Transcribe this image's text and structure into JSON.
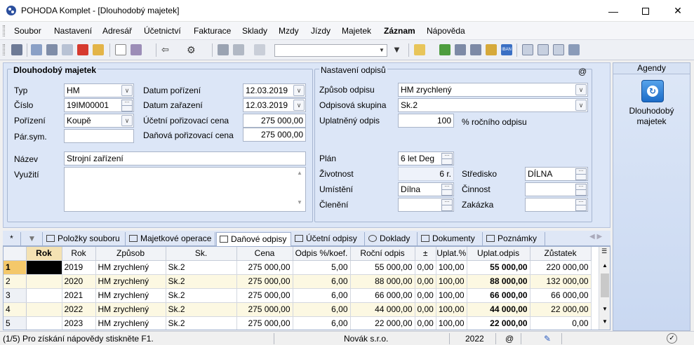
{
  "window": {
    "title": "POHODA Komplet - [Dlouhodobý majetek]"
  },
  "menu": [
    "Soubor",
    "Nastavení",
    "Adresář",
    "Účetnictví",
    "Fakturace",
    "Sklady",
    "Mzdy",
    "Jízdy",
    "Majetek",
    "Záznam",
    "Nápověda"
  ],
  "form": {
    "section_title": "Dlouhodobý majetek",
    "typ_label": "Typ",
    "typ_value": "HM",
    "cislo_label": "Číslo",
    "cislo_value": "19IM00001",
    "porizeni_label": "Pořízení",
    "porizeni_value": "Koupě",
    "parsym_label": "Pár.sym.",
    "datum_porizeni_label": "Datum pořízení",
    "datum_porizeni_value": "12.03.2019",
    "datum_zarazeni_label": "Datum zařazení",
    "datum_zarazeni_value": "12.03.2019",
    "ucetni_cena_label": "Účetní pořizovací cena",
    "ucetni_cena_value": "275 000,00",
    "danova_cena_label": "Daňová pořizovací cena",
    "danova_cena_value": "275 000,00",
    "nazev_label": "Název",
    "nazev_value": "Strojní zařízení",
    "vyuziti_label": "Využití"
  },
  "odpisy": {
    "section_title": "Nastavení odpisů",
    "at": "@",
    "zpusob_label": "Způsob odpisu",
    "zpusob_value": "HM zrychlený",
    "skupina_label": "Odpisová skupina",
    "skupina_value": "Sk.2",
    "uplatneny_label": "Uplatněný odpis",
    "uplatneny_value": "100",
    "uplatneny_unit": "% ročního odpisu",
    "plan_label": "Plán",
    "plan_value": "6 let Deg",
    "zivotnost_label": "Životnost",
    "zivotnost_value": "6 r.",
    "umisteni_label": "Umístění",
    "umisteni_value": "Dílna",
    "cleneni_label": "Členění",
    "stredisko_label": "Středisko",
    "stredisko_value": "DÍLNA",
    "cinnost_label": "Činnost",
    "zakazka_label": "Zakázka"
  },
  "agendy": {
    "header": "Agendy",
    "item": "Dlouhodobý majetek"
  },
  "tabs": [
    "*",
    "Položky souboru",
    "Majetkové operace",
    "Daňové odpisy",
    "Účetní odpisy",
    "Doklady",
    "Dokumenty",
    "Poznámky"
  ],
  "table": {
    "columns": [
      "Rok",
      "Rok",
      "Způsob",
      "Sk.",
      "Cena",
      "Odpis %/koef.",
      "Roční odpis",
      "±",
      "Uplat.%",
      "Uplat.odpis",
      "Zůstatek"
    ],
    "rows": [
      {
        "n": "1",
        "rok": "2019",
        "zpusob": "HM zrychlený",
        "sk": "Sk.2",
        "cena": "275 000,00",
        "odpis": "5,00",
        "rocni": "55 000,00",
        "pm": "0,00",
        "uplat": "100,00",
        "uplodpis": "55 000,00",
        "zustatek": "220 000,00"
      },
      {
        "n": "2",
        "rok": "2020",
        "zpusob": "HM zrychlený",
        "sk": "Sk.2",
        "cena": "275 000,00",
        "odpis": "6,00",
        "rocni": "88 000,00",
        "pm": "0,00",
        "uplat": "100,00",
        "uplodpis": "88 000,00",
        "zustatek": "132 000,00"
      },
      {
        "n": "3",
        "rok": "2021",
        "zpusob": "HM zrychlený",
        "sk": "Sk.2",
        "cena": "275 000,00",
        "odpis": "6,00",
        "rocni": "66 000,00",
        "pm": "0,00",
        "uplat": "100,00",
        "uplodpis": "66 000,00",
        "zustatek": "66 000,00"
      },
      {
        "n": "4",
        "rok": "2022",
        "zpusob": "HM zrychlený",
        "sk": "Sk.2",
        "cena": "275 000,00",
        "odpis": "6,00",
        "rocni": "44 000,00",
        "pm": "0,00",
        "uplat": "100,00",
        "uplodpis": "44 000,00",
        "zustatek": "22 000,00"
      },
      {
        "n": "5",
        "rok": "2023",
        "zpusob": "HM zrychlený",
        "sk": "Sk.2",
        "cena": "275 000,00",
        "odpis": "6,00",
        "rocni": "22 000,00",
        "pm": "0,00",
        "uplat": "100,00",
        "uplodpis": "22 000,00",
        "zustatek": "0,00"
      }
    ]
  },
  "status": {
    "help": "(1/5) Pro získání nápovědy stiskněte F1.",
    "company": "Novák s.r.o.",
    "year": "2022",
    "at": "@"
  }
}
